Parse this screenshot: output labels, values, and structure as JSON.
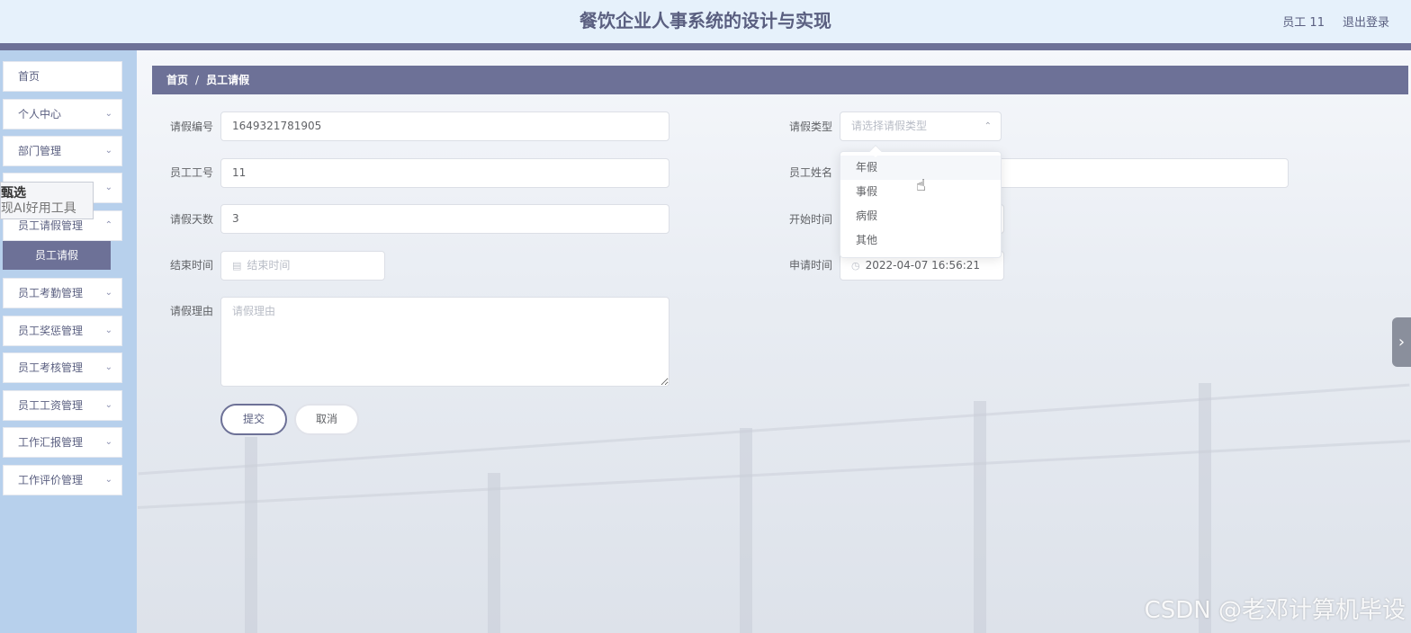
{
  "header": {
    "title": "餐饮企业人事系统的设计与实现",
    "user": "员工 11",
    "logout": "退出登录"
  },
  "sidebar": {
    "items": [
      {
        "label": "首页",
        "chevron": false
      },
      {
        "label": "个人中心",
        "chevron": true
      },
      {
        "label": "部门管理",
        "chevron": true
      },
      {
        "label": "",
        "chevron": true
      },
      {
        "label": "员工请假管理",
        "chevron": true
      },
      {
        "label": "员工考勤管理",
        "chevron": true
      },
      {
        "label": "员工奖惩管理",
        "chevron": true
      },
      {
        "label": "员工考核管理",
        "chevron": true
      },
      {
        "label": "员工工资管理",
        "chevron": true
      },
      {
        "label": "工作汇报管理",
        "chevron": true
      },
      {
        "label": "工作评价管理",
        "chevron": true
      }
    ],
    "active_sub": "员工请假"
  },
  "ad_popup": {
    "line1": "甄选",
    "line2": "现AI好用工具"
  },
  "breadcrumb": {
    "home": "首页",
    "separator": "/",
    "current": "员工请假"
  },
  "form": {
    "leave_no_label": "请假编号",
    "leave_no_value": "1649321781905",
    "leave_type_label": "请假类型",
    "leave_type_placeholder": "请选择请假类型",
    "emp_no_label": "员工工号",
    "emp_no_value": "11",
    "emp_name_label": "员工姓名",
    "days_label": "请假天数",
    "days_value": "3",
    "start_label": "开始时间",
    "end_label": "结束时间",
    "end_placeholder": "结束时间",
    "apply_label": "申请时间",
    "apply_value": "2022-04-07 16:56:21",
    "reason_label": "请假理由",
    "reason_placeholder": "请假理由",
    "submit": "提交",
    "cancel": "取消"
  },
  "dropdown": {
    "options": [
      "年假",
      "事假",
      "病假",
      "其他"
    ],
    "hovered": "年假"
  },
  "watermark": "CSDN @老邓计算机毕设",
  "colors": {
    "accent": "#6d7197",
    "sidebar_bg": "#b7d0ec",
    "header_bg": "#e6f1fb"
  }
}
